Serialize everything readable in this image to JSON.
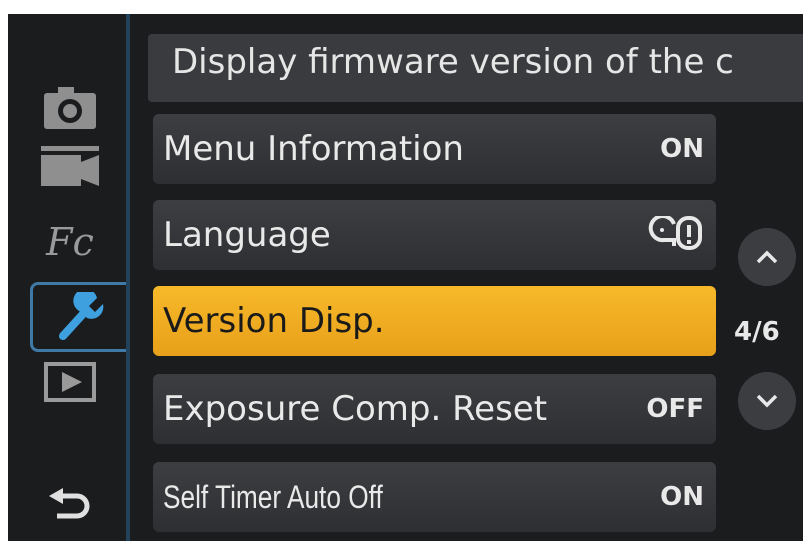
{
  "help_text": "Display firmware version of the c",
  "tabs": [
    {
      "name": "camera-icon"
    },
    {
      "name": "video-camera-icon"
    },
    {
      "name": "custom-fc-icon",
      "text": "Fc"
    },
    {
      "name": "wrench-icon"
    },
    {
      "name": "playback-icon"
    },
    {
      "name": "back-arrow-icon"
    }
  ],
  "menu": {
    "items": [
      {
        "label": "Menu Information",
        "value": "ON"
      },
      {
        "label": "Language",
        "value_icon": "language-head-icon"
      },
      {
        "label": "Version Disp.",
        "value": ""
      },
      {
        "label": "Exposure Comp. Reset",
        "value": "OFF"
      },
      {
        "label": "Self Timer Auto Off",
        "value": "ON"
      }
    ]
  },
  "pagination": {
    "indicator": "4/6"
  },
  "colors": {
    "selected": "#f0ad22",
    "active_tab": "#3f79a6",
    "background": "#1b1c1e"
  }
}
